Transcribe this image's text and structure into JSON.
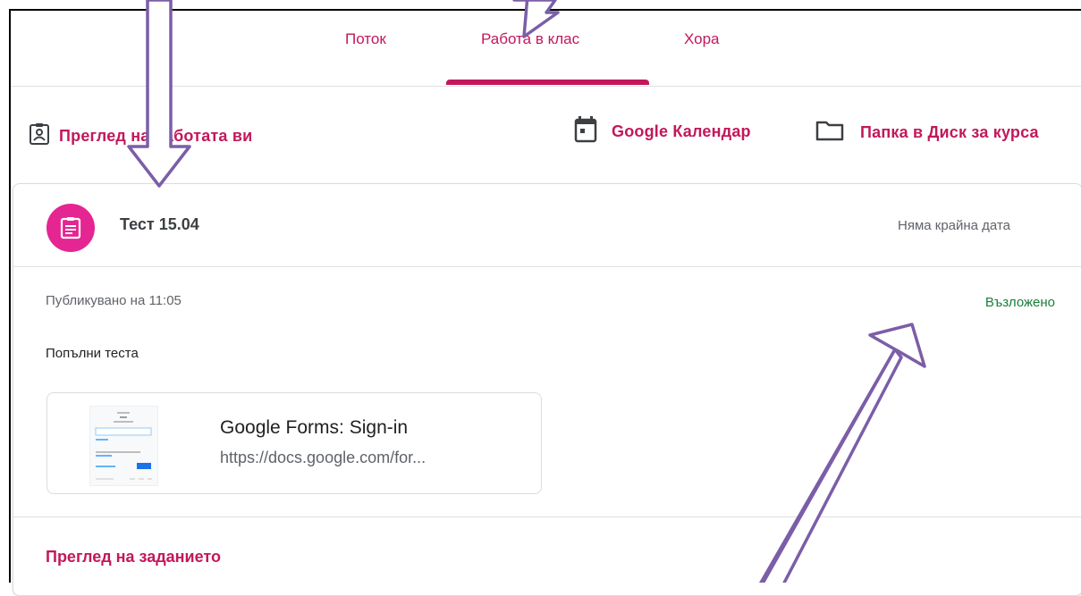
{
  "nav": {
    "tabs": [
      {
        "label": "Поток"
      },
      {
        "label": "Работа в клас",
        "active": true
      },
      {
        "label": "Хора"
      }
    ]
  },
  "toolbar": {
    "view_work": "Преглед на работата ви",
    "calendar": "Google Календар",
    "drive_folder": "Папка в Диск за курса"
  },
  "assignment": {
    "title": "Тест 15.04",
    "due": "Няма крайна дата",
    "published": "Публикувано на 11:05",
    "status": "Възложено",
    "instructions": "Попълни теста",
    "attachment": {
      "title": "Google Forms: Sign-in",
      "url": "https://docs.google.com/for..."
    },
    "view_link": "Преглед на заданието"
  },
  "colors": {
    "accent": "#c2185b",
    "assignment_icon_bg": "#e52592",
    "status_green": "#188038",
    "annotation_arrow": "#7b5ea7"
  },
  "icons": {
    "view_work": "assignment-ind-icon",
    "calendar": "calendar-icon",
    "drive_folder": "folder-icon",
    "assignment": "assignment-icon"
  }
}
